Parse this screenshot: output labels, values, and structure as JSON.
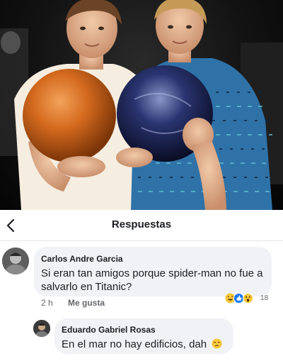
{
  "header": {
    "title": "Respuestas",
    "back_icon": "chevron-left-icon"
  },
  "photo": {
    "subject": "two-boys-holding-bowling-balls",
    "ball_left_color": "#d46a1e",
    "ball_right_color": "#2a3470"
  },
  "comments": [
    {
      "author": "Carlos Andre Garcia",
      "text": "Si eran tan amigos porque spider-man no fue a salvarlo en Titanic?",
      "time": "2 h",
      "like_label": "Me gusta",
      "reactions": [
        "haha-icon",
        "like-icon",
        "wow-icon"
      ],
      "reaction_count": "18"
    },
    {
      "author": "Eduardo Gabriel Rosas",
      "text": "En el mar no hay edificios, dah",
      "emoji": "unamused-face-icon"
    }
  ],
  "colors": {
    "bubble": "#f0f2f5",
    "meta_text": "#65676b",
    "like_blue": "#1877f2",
    "reaction_yellow": "#f7c83a"
  }
}
